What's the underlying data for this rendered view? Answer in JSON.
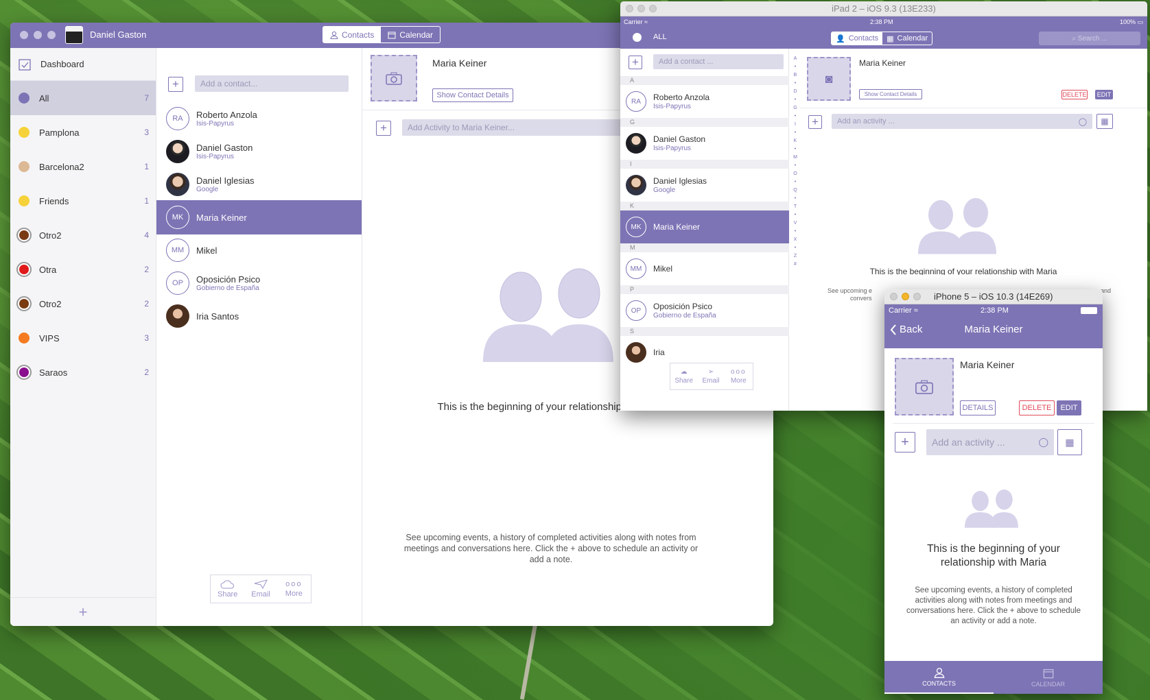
{
  "mac": {
    "user_name": "Daniel Gaston",
    "tab_contacts": "Contacts",
    "tab_calendar": "Calendar",
    "sidebar": {
      "dashboard_label": "Dashboard",
      "groups": [
        {
          "label": "All",
          "count": "7",
          "color": "#7d74b5"
        },
        {
          "label": "Pamplona",
          "count": "3",
          "color": "#f6d23a"
        },
        {
          "label": "Barcelona2",
          "count": "1",
          "color": "#dcb995"
        },
        {
          "label": "Friends",
          "count": "1",
          "color": "#f6d23a"
        },
        {
          "label": "Otro2",
          "count": "4",
          "color": "#7a3a12"
        },
        {
          "label": "Otra",
          "count": "2",
          "color": "#e01a1a"
        },
        {
          "label": "Otro2",
          "count": "2",
          "color": "#7a3a12"
        },
        {
          "label": "VIPS",
          "count": "3",
          "color": "#f47b22"
        },
        {
          "label": "Saraos",
          "count": "2",
          "color": "#8a1090"
        }
      ],
      "add_symbol": "+"
    },
    "add_contact_placeholder": "Add a contact...",
    "contacts": [
      {
        "initials": "RA",
        "name": "Roberto Anzola",
        "sub": "Isis-Papyrus"
      },
      {
        "initials": "",
        "name": "Daniel Gaston",
        "sub": "Isis-Papyrus"
      },
      {
        "initials": "",
        "name": "Daniel Iglesias",
        "sub": "Google"
      },
      {
        "initials": "MK",
        "name": "Maria Keiner",
        "sub": ""
      },
      {
        "initials": "MM",
        "name": "Mikel",
        "sub": ""
      },
      {
        "initials": "OP",
        "name": "Oposición Psico",
        "sub": "Gobierno de España"
      },
      {
        "initials": "",
        "name": "Iria  Santos",
        "sub": ""
      }
    ],
    "actions": {
      "share": "Share",
      "email": "Email",
      "more": "More",
      "more_glyph": "ooo"
    },
    "detail": {
      "name": "Maria Keiner",
      "show_details": "Show Contact Details",
      "add_activity_placeholder": "Add Activity to Maria Keiner...",
      "empty_title": "This is the beginning of your relationship with Maria",
      "empty_text": "See upcoming events, a history of completed activities along with notes from meetings and conversations here.  Click the + above to schedule an activity or add a note."
    }
  },
  "ipad": {
    "sim_title": "iPad 2 – iOS 9.3 (13E233)",
    "carrier": "Carrier",
    "time": "2:38 PM",
    "battery": "100%",
    "all_label": "ALL",
    "tab_contacts": "Contacts",
    "tab_calendar": "Calendar",
    "search_placeholder": "Search ...",
    "add_contact_placeholder": "Add a contact ...",
    "sections": [
      "A",
      "G",
      "I",
      "K",
      "M",
      "P",
      "S"
    ],
    "index": [
      "A",
      "•",
      "B",
      "•",
      "D",
      "•",
      "G",
      "•",
      "I",
      "•",
      "K",
      "•",
      "M",
      "•",
      "O",
      "•",
      "Q",
      "•",
      "T",
      "•",
      "V",
      "•",
      "X",
      "•",
      "Z",
      "#"
    ],
    "contacts": [
      {
        "initials": "RA",
        "name": "Roberto Anzola",
        "sub": "Isis-Papyrus"
      },
      {
        "initials": "",
        "name": "Daniel Gaston",
        "sub": "Isis-Papyrus"
      },
      {
        "initials": "",
        "name": "Daniel Iglesias",
        "sub": "Google"
      },
      {
        "initials": "MK",
        "name": "Maria Keiner",
        "sub": ""
      },
      {
        "initials": "MM",
        "name": "Mikel",
        "sub": ""
      },
      {
        "initials": "OP",
        "name": "Oposición Psico",
        "sub": "Gobierno de España"
      },
      {
        "initials": "",
        "name": "Iria",
        "sub": ""
      }
    ],
    "actions": {
      "share": "Share",
      "email": "Email",
      "more": "More",
      "more_glyph": "ooo"
    },
    "detail": {
      "name": "Maria Keiner",
      "show_details": "Show Contact Details",
      "delete": "DELETE",
      "edit": "EDIT",
      "add_activity_placeholder": "Add an activity ...",
      "empty_title_partial": "This is the beginning of your relationship with Maria",
      "empty_text_left": "See upcoming e",
      "empty_text_left2": "convers",
      "empty_text_right": "and"
    }
  },
  "iphone": {
    "sim_title": "iPhone 5 – iOS 10.3 (14E269)",
    "carrier": "Carrier",
    "time": "2:38 PM",
    "back": "Back",
    "title": "Maria Keiner",
    "name": "Maria Keiner",
    "details": "DETAILS",
    "delete": "DELETE",
    "edit": "EDIT",
    "add_activity_placeholder": "Add an activity ...",
    "empty_title": "This is the beginning of your relationship with Maria",
    "empty_text": "See upcoming events, a history of completed activities along with notes from meetings and conversations here. Click the + above to schedule an activity or add a note.",
    "tab_contacts": "CONTACTS",
    "tab_calendar": "CALENDAR"
  },
  "colors": {
    "accent": "#7d74b5",
    "danger": "#e04a5a"
  }
}
